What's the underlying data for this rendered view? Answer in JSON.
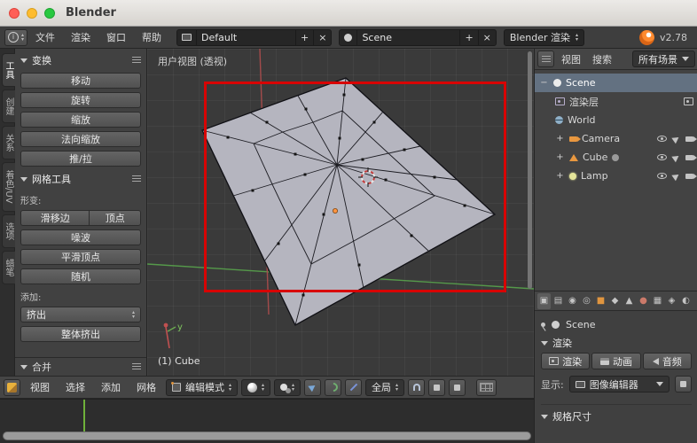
{
  "window": {
    "title": "Blender"
  },
  "menubar": {
    "menus": [
      "文件",
      "渲染",
      "窗口",
      "帮助"
    ],
    "layout": {
      "value": "Default",
      "add": "+",
      "close": "×"
    },
    "scene": {
      "value": "Scene",
      "add": "+",
      "close": "×"
    },
    "engine": {
      "value": "Blender 渲染"
    },
    "version": "v2.78"
  },
  "toolshelf": {
    "tabs": [
      "工具",
      "创建",
      "关系",
      "着色/UV",
      "选项",
      "蜡笔"
    ],
    "transform": {
      "title": "变换",
      "buttons": [
        "移动",
        "旋转",
        "缩放",
        "法向缩放",
        "推/拉"
      ]
    },
    "mesh_tools": {
      "title": "网格工具",
      "deform_label": "形变:",
      "edge_slide": "滑移边",
      "vertex_slide": "顶点",
      "noise": "噪波",
      "smooth_vertex": "平滑顶点",
      "randomize": "随机",
      "add_label": "添加:",
      "extrude_menu": "挤出",
      "extrude_individual": "整体挤出"
    },
    "merge": {
      "title": "合并"
    }
  },
  "viewport": {
    "view_label": "用户视图 (透视)",
    "object_info": "(1) Cube",
    "axis_y": "y"
  },
  "view3d_header": {
    "menus": [
      "视图",
      "选择",
      "添加",
      "网格"
    ],
    "mode": "编辑模式",
    "orientation": "全局"
  },
  "outliner": {
    "menus": [
      "视图",
      "搜索"
    ],
    "display_mode": "所有场景",
    "scene_label": "Scene",
    "items": [
      {
        "label": "渲染层"
      },
      {
        "label": "World"
      },
      {
        "label": "Camera"
      },
      {
        "label": "Cube"
      },
      {
        "label": "Lamp"
      }
    ]
  },
  "properties": {
    "context": "Scene",
    "render": {
      "title": "渲染",
      "render_btn": "渲染",
      "animation_btn": "动画",
      "audio_btn": "音频",
      "display_label": "显示:",
      "display_value": "图像编辑器"
    },
    "dimensions": {
      "title": "规格尺寸"
    }
  }
}
